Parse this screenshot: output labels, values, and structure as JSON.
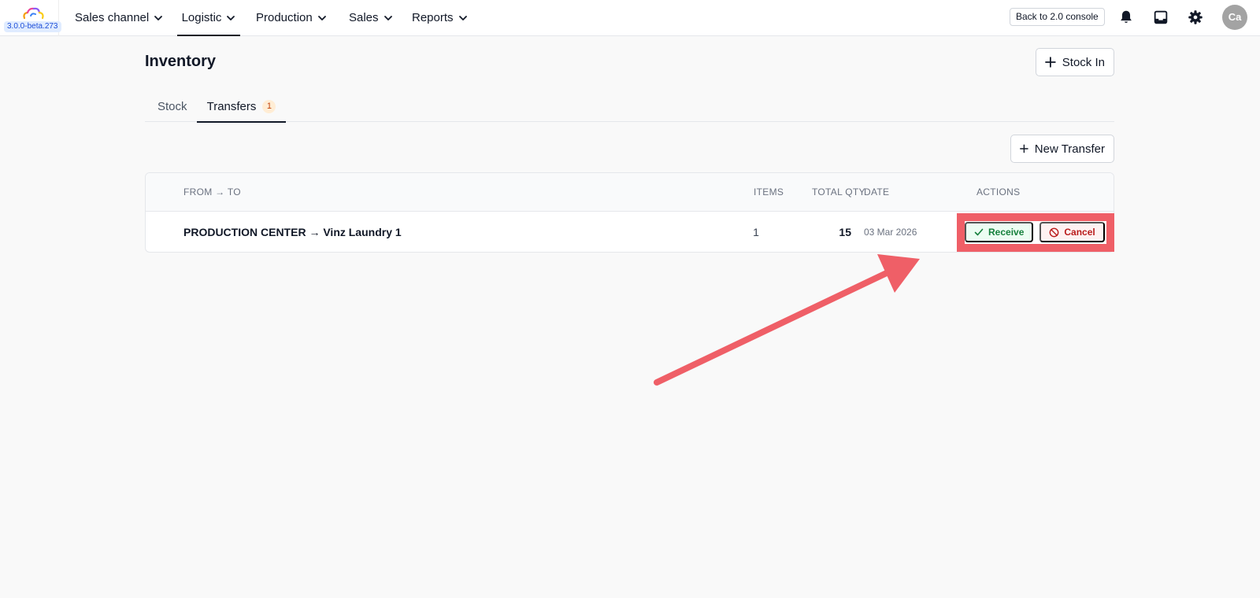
{
  "app": {
    "version": "3.0.0-beta.273",
    "logo_icon": "cloud-logo-icon"
  },
  "nav": {
    "items": [
      {
        "label": "Sales channel",
        "active": false
      },
      {
        "label": "Logistic",
        "active": true
      },
      {
        "label": "Production",
        "active": false
      },
      {
        "label": "Sales",
        "active": false
      },
      {
        "label": "Reports",
        "active": false
      }
    ],
    "back_console_label": "Back to 2.0 console",
    "icons": [
      "bell-icon",
      "inbox-icon",
      "gear-icon"
    ],
    "avatar_initials": "Ca"
  },
  "page": {
    "title": "Inventory",
    "stock_in_label": "Stock In",
    "new_transfer_label": "New Transfer"
  },
  "tabs": [
    {
      "label": "Stock",
      "active": false
    },
    {
      "label": "Transfers",
      "active": true,
      "count": "1"
    }
  ],
  "table": {
    "headers": {
      "route": "FROM → TO",
      "items": "ITEMS",
      "total_qty": "TOTAL QTY",
      "date": "DATE",
      "actions": "ACTIONS"
    },
    "rows": [
      {
        "route": "PRODUCTION CENTER → Vinz Laundry 1",
        "items": "1",
        "total_qty": "15",
        "date": "03 Mar 2026",
        "receive_label": "Receive",
        "cancel_label": "Cancel"
      }
    ]
  },
  "colors": {
    "annotation": "#ef5f67",
    "receive": "#15803d",
    "cancel": "#b91c1c",
    "badge": "#c2410c"
  }
}
